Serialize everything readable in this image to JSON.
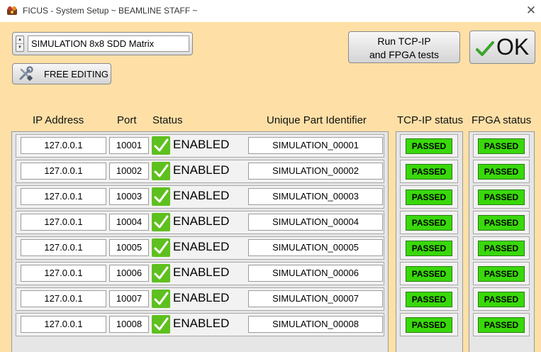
{
  "window": {
    "title": "FICUS - System Setup ~ BEAMLINE STAFF ~",
    "close_symbol": "✕"
  },
  "controls": {
    "mode_value": "SIMULATION 8x8 SDD Matrix",
    "free_editing_label": "FREE EDITING",
    "run_tests_line1": "Run TCP-IP",
    "run_tests_line2": "and FPGA tests",
    "ok_label": "OK"
  },
  "headers": {
    "ip": "IP Address",
    "port": "Port",
    "status": "Status",
    "uid": "Unique Part Identifier",
    "tcp": "TCP-IP status",
    "fpga": "FPGA status"
  },
  "colors": {
    "background": "#fee0a6",
    "enabled_check": "#5ec01e",
    "passed": "#39d80b"
  },
  "icons": {
    "app": "ficus-app-icon",
    "tools": "wrench-screwdriver-icon",
    "ok": "green-checkmark-icon",
    "status": "checkmark-icon"
  },
  "rows": [
    {
      "ip": "127.0.0.1",
      "port": "10001",
      "status": "ENABLED",
      "uid": "SIMULATION_00001",
      "tcp": "PASSED",
      "fpga": "PASSED"
    },
    {
      "ip": "127.0.0.1",
      "port": "10002",
      "status": "ENABLED",
      "uid": "SIMULATION_00002",
      "tcp": "PASSED",
      "fpga": "PASSED"
    },
    {
      "ip": "127.0.0.1",
      "port": "10003",
      "status": "ENABLED",
      "uid": "SIMULATION_00003",
      "tcp": "PASSED",
      "fpga": "PASSED"
    },
    {
      "ip": "127.0.0.1",
      "port": "10004",
      "status": "ENABLED",
      "uid": "SIMULATION_00004",
      "tcp": "PASSED",
      "fpga": "PASSED"
    },
    {
      "ip": "127.0.0.1",
      "port": "10005",
      "status": "ENABLED",
      "uid": "SIMULATION_00005",
      "tcp": "PASSED",
      "fpga": "PASSED"
    },
    {
      "ip": "127.0.0.1",
      "port": "10006",
      "status": "ENABLED",
      "uid": "SIMULATION_00006",
      "tcp": "PASSED",
      "fpga": "PASSED"
    },
    {
      "ip": "127.0.0.1",
      "port": "10007",
      "status": "ENABLED",
      "uid": "SIMULATION_00007",
      "tcp": "PASSED",
      "fpga": "PASSED"
    },
    {
      "ip": "127.0.0.1",
      "port": "10008",
      "status": "ENABLED",
      "uid": "SIMULATION_00008",
      "tcp": "PASSED",
      "fpga": "PASSED"
    }
  ]
}
